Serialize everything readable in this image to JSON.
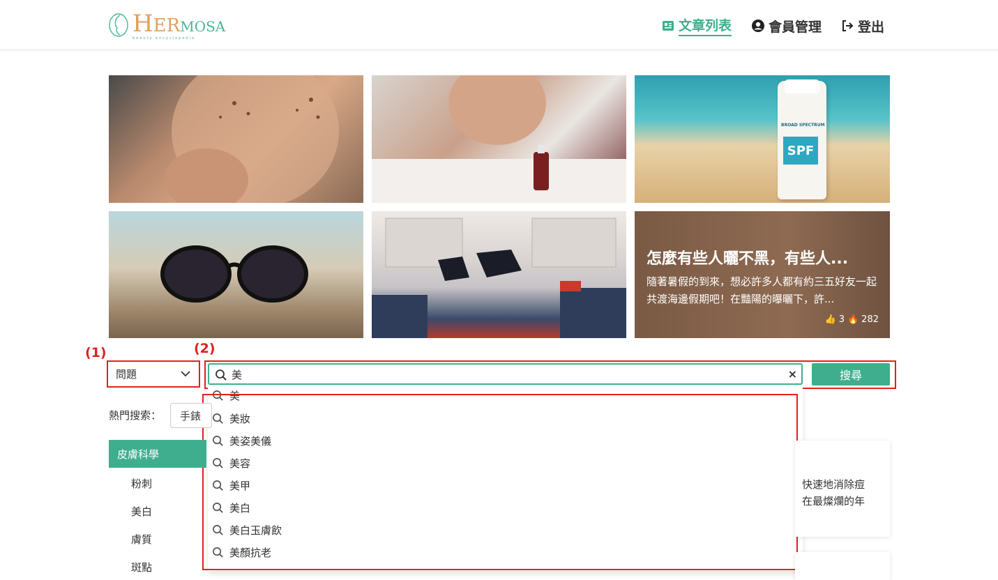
{
  "header": {
    "logo_text_h": "H",
    "logo_text_er": "ER",
    "logo_text_mosa": "MOSA",
    "logo_tagline": "beauty encyclopedia",
    "nav": [
      {
        "label": "文章列表",
        "icon": "book-icon",
        "active": true
      },
      {
        "label": "會員管理",
        "icon": "user-circle-icon",
        "active": false
      },
      {
        "label": "登出",
        "icon": "logout-icon",
        "active": false
      }
    ]
  },
  "featured": {
    "tile6_title": "怎麼有些人曬不黑，有些人...",
    "tile6_desc": "隨著暑假的到來，想必許多人都有約三五好友一起共渡海邊假期吧！在豔陽的曝曬下，許...",
    "tile6_likes": "3",
    "tile6_views": "282",
    "sunscreen_text": "BROAD SPECTRUM",
    "sunscreen_spf": "SPF"
  },
  "annotations": {
    "one": "(1)",
    "two": "(2)"
  },
  "search": {
    "category_value": "問題",
    "query": "美",
    "clear_symbol": "×",
    "button_label": "搜尋",
    "suggestions": [
      "美",
      "美妝",
      "美姿美儀",
      "美容",
      "美甲",
      "美白",
      "美白玉膚飲",
      "美顏抗老"
    ]
  },
  "hot_search": {
    "label": "熱門搜索：",
    "chip": "手錶"
  },
  "sidebar": {
    "heading": "皮膚科學",
    "items": [
      "粉刺",
      "美白",
      "膚質",
      "斑點"
    ]
  },
  "article_card": {
    "line1": "快速地消除痘",
    "line2": "在最燦爛的年"
  },
  "colors": {
    "accent": "#3fae8e",
    "annotation": "#e02020",
    "logo_gold": "#e0a05a"
  }
}
